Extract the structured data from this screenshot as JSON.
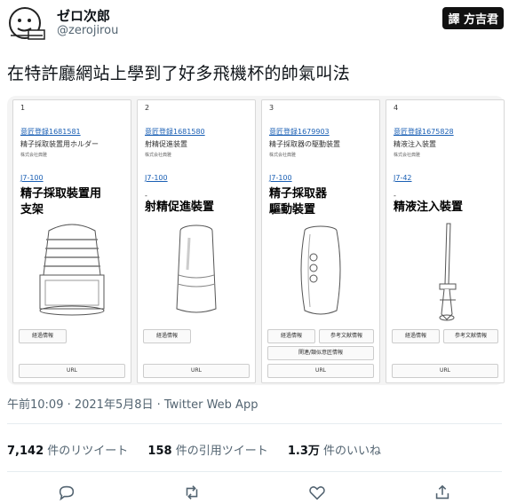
{
  "author": {
    "display_name": "ゼロ次郎",
    "handle": "@zerojirou"
  },
  "translator_badge": "譯 方吉君",
  "tweet_text": "在特許廳網站上學到了好多飛機杯的帥氣叫法",
  "cards": [
    {
      "num": "1",
      "reg": "意匠登録1681581",
      "jp": "精子採取装置用ホルダー",
      "company": "株式会社典雅",
      "code": "J7-100",
      "cn_lines": [
        "精子採取裝置用",
        "支架"
      ],
      "buttons": [
        "経過情報",
        "URL"
      ]
    },
    {
      "num": "2",
      "reg": "意匠登録1681580",
      "jp": "射精促進装置",
      "company": "株式会社典雅",
      "code": "J7-100",
      "cn_lines": [
        "射精促進裝置"
      ],
      "buttons": [
        "経過情報",
        "URL"
      ]
    },
    {
      "num": "3",
      "reg": "意匠登録1679903",
      "jp": "精子採取器の駆動装置",
      "company": "株式会社典雅",
      "code": "J7-100",
      "cn_lines": [
        "精子採取器",
        "驅動裝置"
      ],
      "buttons": [
        "経過情報",
        "参考文献情報",
        "関連/類似意匠情報",
        "URL"
      ]
    },
    {
      "num": "4",
      "reg": "意匠登録1675828",
      "jp": "精液注入装置",
      "company": "株式会社典雅",
      "code": "J7-42",
      "cn_lines": [
        "精液注入裝置"
      ],
      "buttons": [
        "経過情報",
        "参考文献情報",
        "URL"
      ]
    }
  ],
  "meta": "午前10:09 · 2021年5月8日 · Twitter Web App",
  "stats": {
    "retweets": "7,142",
    "retweets_label": "件のリツイート",
    "quotes": "158",
    "quotes_label": "件の引用ツイート",
    "likes": "1.3万",
    "likes_label": "件のいいね"
  },
  "icons": [
    "reply-icon",
    "retweet-icon",
    "like-icon",
    "share-icon"
  ]
}
